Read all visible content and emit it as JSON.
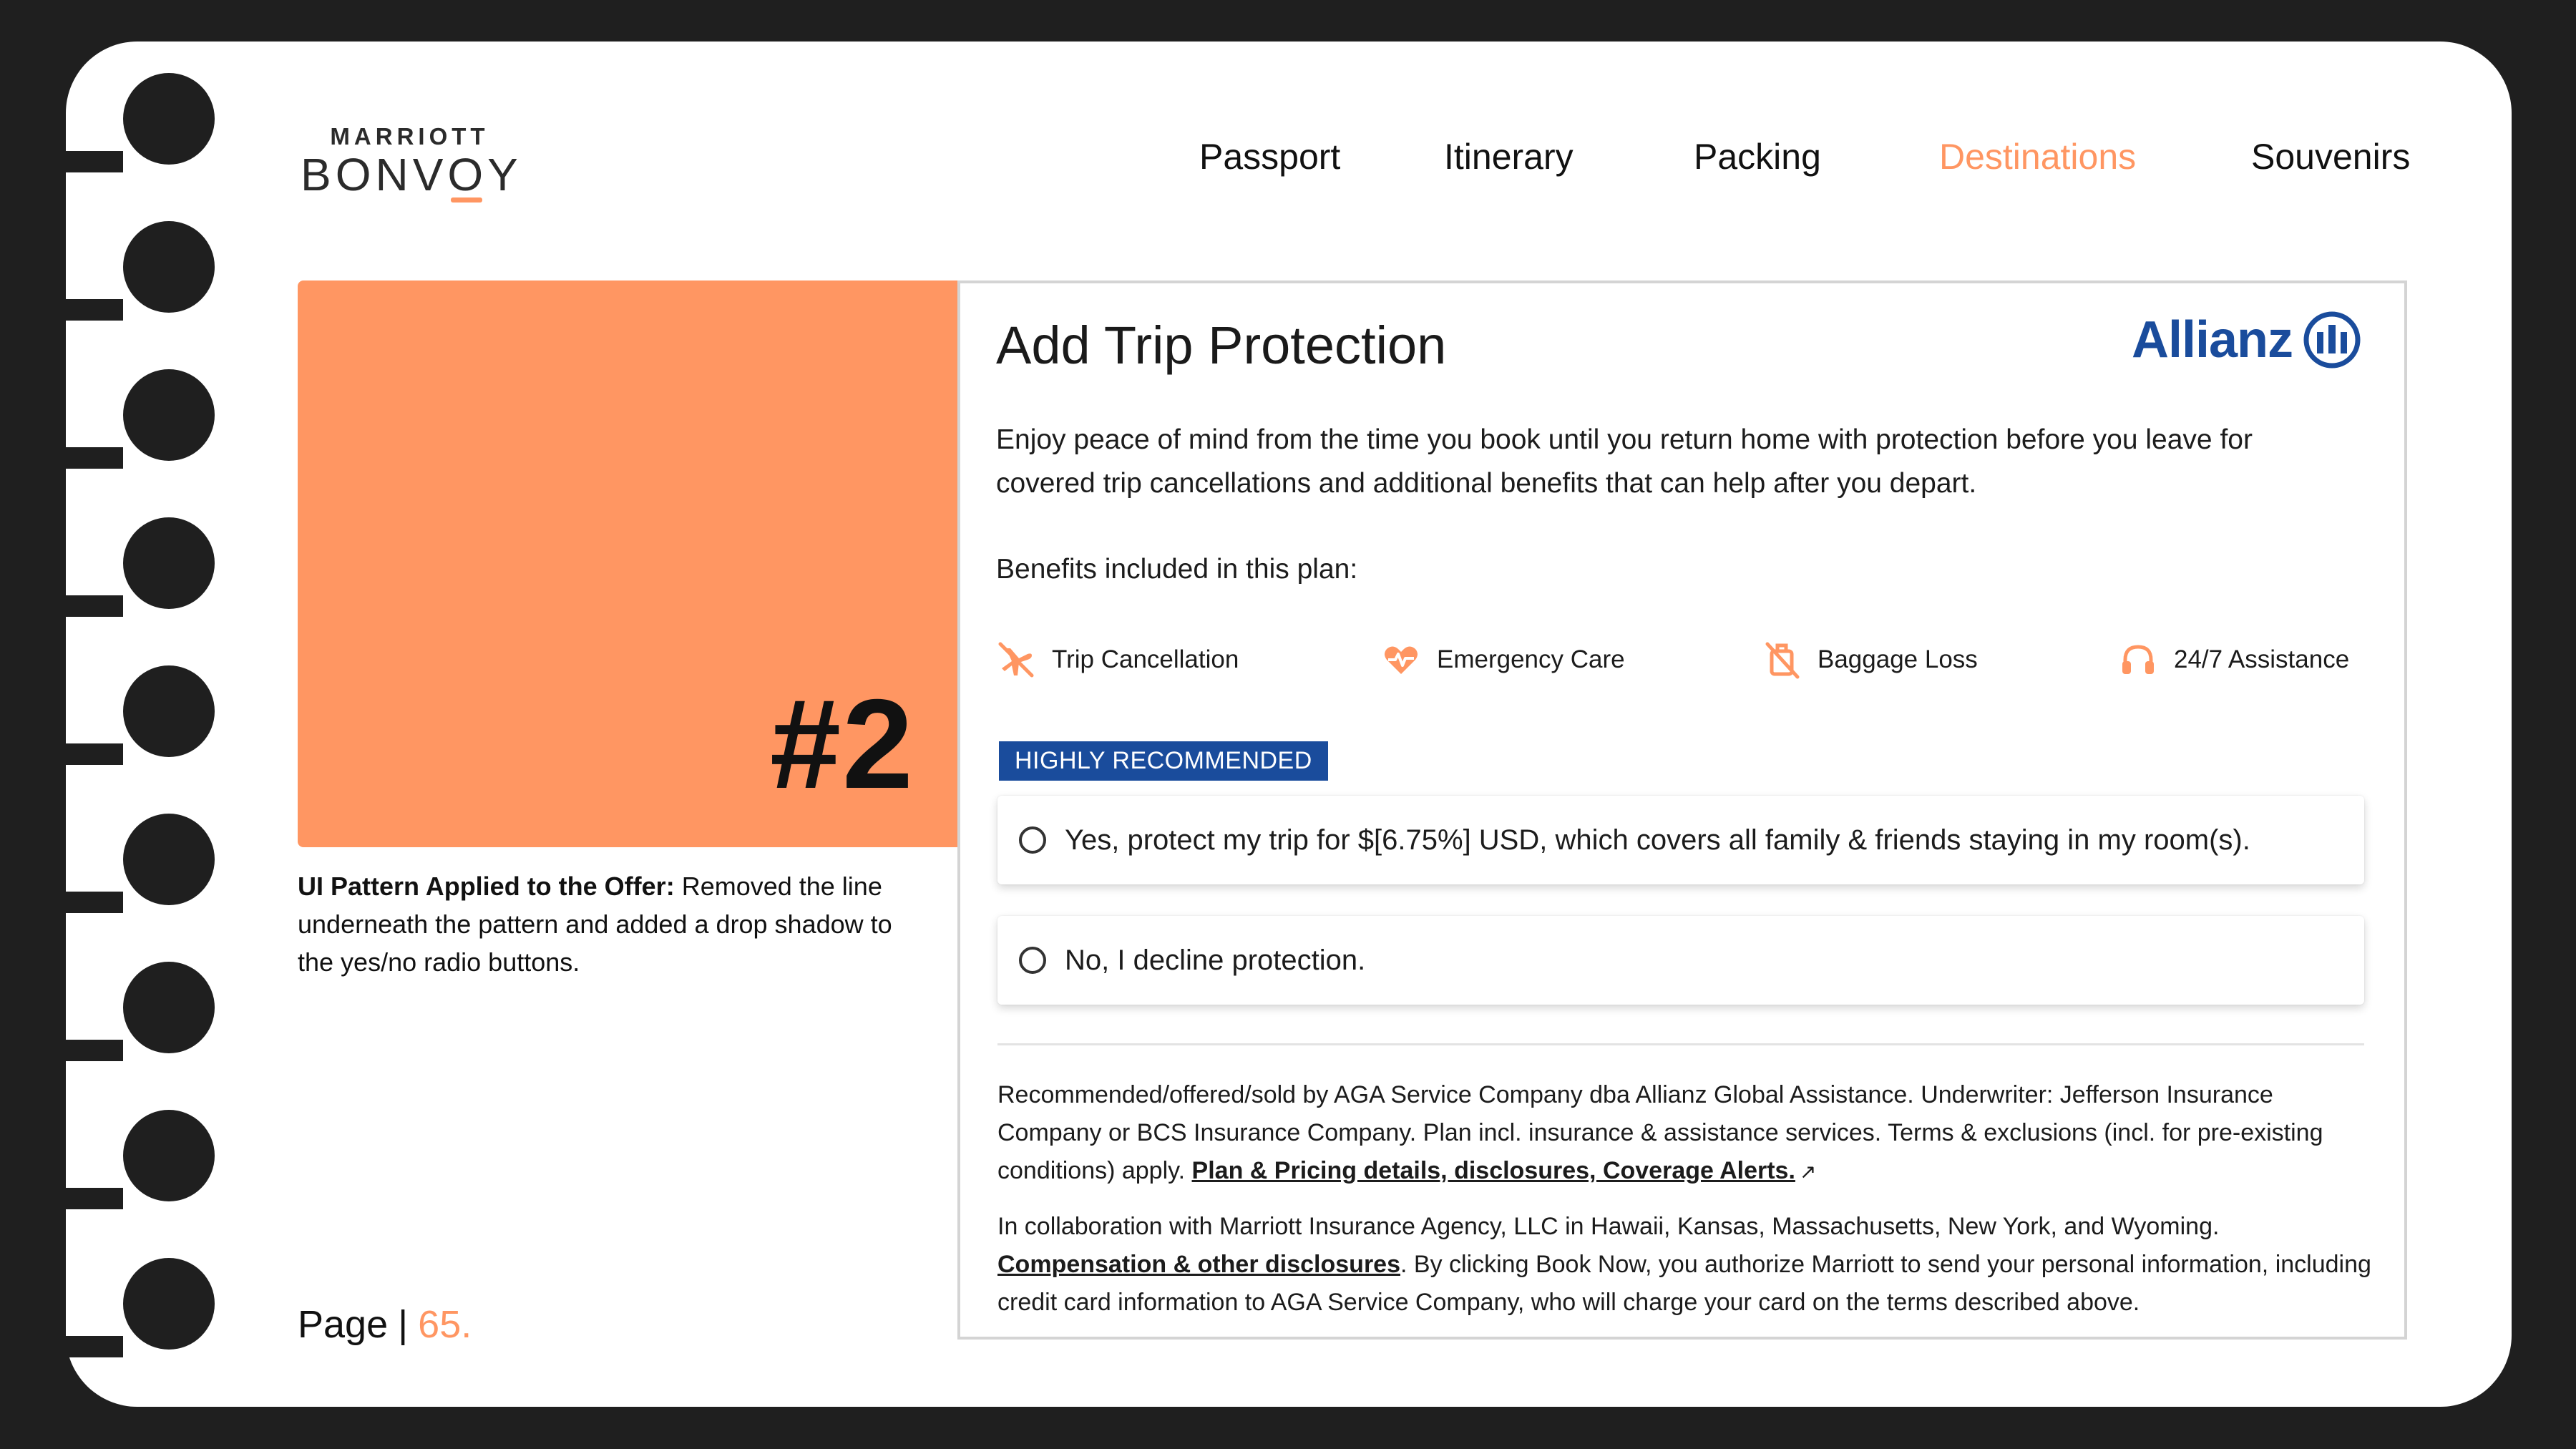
{
  "brand": {
    "line1": "MARRIOTT",
    "line2": "BONVOY"
  },
  "nav": {
    "items": [
      {
        "label": "Passport"
      },
      {
        "label": "Itinerary"
      },
      {
        "label": "Packing"
      },
      {
        "label": "Destinations",
        "active": true
      },
      {
        "label": "Souvenirs"
      }
    ]
  },
  "pattern": {
    "number": "#2"
  },
  "note": {
    "heading": "UI Pattern Applied to the Offer:",
    "text": " Removed the line underneath the pattern and added a drop shadow to the yes/no radio buttons."
  },
  "footer": {
    "page_label": "Page",
    "separator": "|",
    "page_number": "65."
  },
  "offer": {
    "title": "Add Trip Protection",
    "partner_logo": "Allianz",
    "intro": "Enjoy peace of mind from the time you book until you return home with protection before you leave for covered trip cancellations and additional benefits that can help after you depart.",
    "benefits_title": "Benefits included in this plan:",
    "benefits": [
      {
        "label": "Trip Cancellation",
        "icon": "plane-cancel-icon"
      },
      {
        "label": "Emergency Care",
        "icon": "heart-pulse-icon"
      },
      {
        "label": "Baggage Loss",
        "icon": "luggage-off-icon"
      },
      {
        "label": "24/7 Assistance",
        "icon": "headset-icon"
      }
    ],
    "badge": "HIGHLY RECOMMENDED",
    "options": [
      {
        "label": "Yes, protect my trip for $[6.75%] USD, which covers all family & friends staying in my room(s).",
        "selected": false
      },
      {
        "label": "No, I decline protection.",
        "selected": false
      }
    ],
    "disclosure1": {
      "text": "Recommended/offered/sold by AGA Service Company dba Allianz Global Assistance. Underwriter: Jefferson Insurance Company or BCS Insurance Company. Plan incl. insurance & assistance services. Terms & exclusions (incl. for pre-existing conditions) apply. ",
      "link": "Plan & Pricing details, disclosures, Coverage Alerts."
    },
    "disclosure2": {
      "text_before": "In collaboration with Marriott Insurance Agency, LLC in Hawaii, Kansas, Massachusetts, New York, and Wyoming. ",
      "link": "Compensation & other disclosures",
      "text_after": ". By clicking Book Now, you authorize Marriott to send your personal information, including credit card information to AGA Service Company, who will charge your card on the terms described above."
    }
  },
  "colors": {
    "accent": "#ff9662",
    "allianz_blue": "#1a4c9c",
    "frame": "#1f1f1f"
  }
}
